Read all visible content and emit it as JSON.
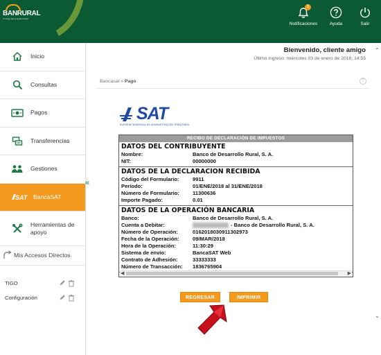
{
  "header": {
    "logo_text": "BANRURAL",
    "logo_tagline": "Un amigo que te ayuda a crecer",
    "actions": [
      {
        "label": "Notificaciones",
        "icon": "bell-icon",
        "badge": "1"
      },
      {
        "label": "Ayuda",
        "icon": "help-icon"
      },
      {
        "label": "Salir",
        "icon": "power-icon"
      }
    ]
  },
  "sidebar": {
    "items": [
      {
        "label": "Inicio",
        "icon": "home-icon"
      },
      {
        "label": "Consultas",
        "icon": "search-icon"
      },
      {
        "label": "Pagos",
        "icon": "money-icon"
      },
      {
        "label": "Transferencias",
        "icon": "transfer-icon"
      },
      {
        "label": "Gestiones",
        "icon": "people-icon"
      },
      {
        "label": "BancaSAT",
        "icon": "sat-icon"
      },
      {
        "label": "Herramientas de apoyo",
        "icon": "tools-icon"
      }
    ],
    "accesos_label": "Mis Accesos Directos",
    "shortcuts": [
      {
        "label": "TIGO"
      },
      {
        "label": "Configuración"
      }
    ]
  },
  "welcome": {
    "greeting": "Bienvenido, cliente amigo",
    "last_login": "Último ingreso: miércoles 03 de enero de 2018, 14:55"
  },
  "breadcrumb": {
    "parent": "Bancasat",
    "separator": "»",
    "current": "Pago"
  },
  "sat_logo": {
    "word": "SAT",
    "subtitle": "SUPERINTENDENCIA DE ADMINISTRACIÓN TRIBUTARIA"
  },
  "receipt": {
    "header": "RECIBO DE DECLARACIÓN DE IMPUESTOS",
    "sections": [
      {
        "title": "DATOS DEL CONTRIBUYENTE",
        "rows": [
          {
            "k": "Nombre:",
            "v": "Banco de Desarrollo Rural, S. A."
          },
          {
            "k": "NIT:",
            "v": "00000000"
          }
        ]
      },
      {
        "title": "DATOS DE LA DECLARACION RECIBIDA",
        "rows": [
          {
            "k": "Código del Formulario:",
            "v": "9911"
          },
          {
            "k": "Período:",
            "v": "01/ENE/2018 al 31/ENE/2018"
          },
          {
            "k": "Número de Formulario:",
            "v": "11300636"
          },
          {
            "k": "Importe Pagado:",
            "v": "0.01"
          }
        ]
      },
      {
        "title": "DATOS DE LA OPERACIÓN BANCARIA",
        "rows": [
          {
            "k": "Banco:",
            "v": "Banco de Desarrollo Rural, S. A."
          },
          {
            "k": "Cuenta a Debitar:",
            "v": "- Banco de Desarrollo Rural, S. A.",
            "masked": true
          },
          {
            "k": "Número de Operación:",
            "v": "0162018030911302973"
          },
          {
            "k": "Fecha de la Operación:",
            "v": "09/MAR/2018"
          },
          {
            "k": "Hora de la Operación:",
            "v": "11:30:29"
          },
          {
            "k": "Sistema de envío:",
            "v": "BancaSAT Web"
          },
          {
            "k": "Contrato de Adhesión:",
            "v": "33333333"
          },
          {
            "k": "Número de Transacción:",
            "v": "1836765904"
          }
        ]
      }
    ]
  },
  "buttons": {
    "back": "REGRESAR",
    "print": "IMPRIMIR"
  },
  "colors": {
    "header_green": "#0b5a33",
    "accent_orange": "#f39a1e",
    "sat_blue": "#1f4aa0",
    "pointer_red": "#c8101a"
  }
}
